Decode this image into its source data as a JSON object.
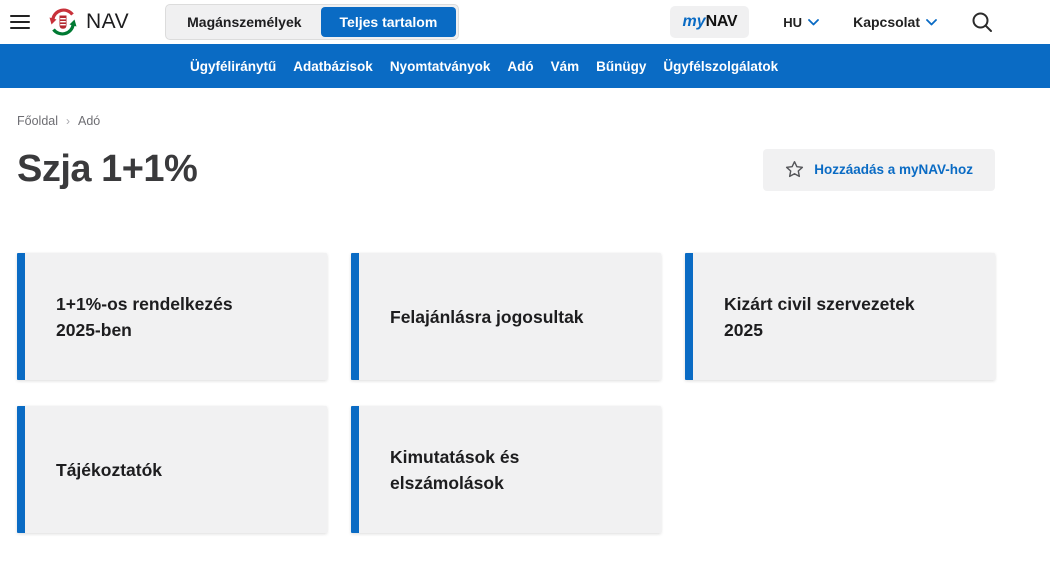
{
  "header": {
    "brand": "NAV",
    "tabs": [
      {
        "label": "Magánszemélyek",
        "active": false
      },
      {
        "label": "Teljes tartalom",
        "active": true
      }
    ],
    "mynav_my": "my",
    "mynav_nav": "NAV",
    "language": "HU",
    "contact": "Kapcsolat"
  },
  "nav": {
    "items": [
      "Ügyféliránytű",
      "Adatbázisok",
      "Nyomtatványok",
      "Adó",
      "Vám",
      "Bűnügy",
      "Ügyfélszolgálatok"
    ]
  },
  "breadcrumb": {
    "home": "Főoldal",
    "separator": "›",
    "current": "Adó"
  },
  "page": {
    "title": "Szja 1+1%",
    "add_button_label": "Hozzáadás a myNAV-hoz"
  },
  "cards": [
    {
      "label": "1+1%-os rendelkezés\n2025-ben"
    },
    {
      "label": "Felajánlásra jogosultak"
    },
    {
      "label": "Kizárt civil szervezetek\n2025"
    },
    {
      "label": "Tájékoztatók"
    },
    {
      "label": "Kimutatások és\nelszámolások"
    }
  ],
  "colors": {
    "accent_blue": "#0a6bc4",
    "card_background": "#f1f1f2",
    "logo_red": "#c8313a",
    "logo_green": "#007a33"
  }
}
